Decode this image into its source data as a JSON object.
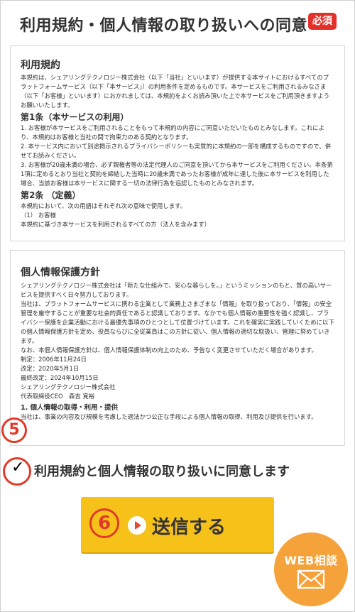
{
  "section": {
    "title": "利用規約・個人情報の取り扱いへの同意",
    "required_badge": "必須"
  },
  "terms": {
    "title": "利用規約",
    "intro": "本規約は、シェアリングテクノロジー株式会社（以下「当社」といいます）が提供する本サイトにおけるすべてのプラットフォームサービス（以下「本サービス」）の利用条件を定めるものです。本サービスをご利用されるみなさま（以下「お客様」といいます）におかれましては、本規約をよくお読み頂いた上で本サービスをご利用頂きますようお願いいたします。",
    "article1_title": "第1条（本サービスの利用）",
    "article1_p1": "1. お客様が本サービスをご利用されることをもって本規約の内容にご同意いただいたものとみなします。これにより、本規約はお客様と当社の間で拘束力のある契約となります。",
    "article1_p2": "2. 本サービス内において別途掲示されるプライバシーポリシーも実質的に本規約の一部を構成するものですので、併せてお読みください。",
    "article1_p3": "3. お客様が20歳未満の場合、必ず親権者等の法定代理人のご同意を頂いてから本サービスをご利用ください。本条第1項に定めるとおり当社と契約を締結した当時に20歳未満であったお客様が成年に達した後に本サービスを利用した場合、当該お客様は本サービスに関する一切の法律行為を追認したものとみなされます。",
    "article2_title": "第2条 （定義）",
    "article2_p1": "本規約において、次の用語はそれぞれ次の意味で使用します。",
    "article2_p2": "（1） お客様",
    "article2_p3": "本規約に基づき本サービスを利用されるすべての方（法人を含みます）"
  },
  "privacy": {
    "title": "個人情報保護方針",
    "p1": "シェアリングテクノロジー株式会社は「新たな仕組みで、安心な暮らしを。」というミッションのもと、質の高いサービスを提供すべく日々努力しております。",
    "p2": "当社は、プラットフォームサービスに携わる企業として業務上さまざまな「情報」を取り扱っており、「情報」の安全管理を厳守することが重要な社会的責任であると認識しております。なかでも個人情報の重要性を強く認識し、プライバシー保護を企業活動における最優先事項のひとつとして位置づけています。これを確実に実践していくために以下の個人情報保護方針を定め、役員ならびに全従業員はこの方針に従い、個人情報の適切な取扱い、管理に努めていきます。",
    "p3": "なお、本個人情報保護方針は、個人情報保護体制の向上のため、予告なく変更させていただく場合があります。",
    "enacted": "制定：2006年11月24日",
    "revised": "改定：2020年5月1日",
    "last_revised": "最終改定：2024年10月15日",
    "company": "シェアリングテクノロジー株式会社",
    "ceo": "代表取締役CEO　森吉 寛裕",
    "item1_title": "1. 個人情報の取得・利用・提供",
    "item1_text": "当社は、事業の内容及び規模を考慮した適法かつ公正な手段による個人情報の取得、利用及び提供を行います。"
  },
  "annotations": {
    "step5": "5",
    "step6": "6"
  },
  "agree": {
    "check_mark": "✓",
    "label": "利用規約と個人情報の取り扱いに同意します",
    "checked": true
  },
  "submit": {
    "label": "送信する"
  },
  "web_consult": {
    "label": "WEB相談",
    "icon": "mail-icon"
  },
  "colors": {
    "required": "#e0312b",
    "submit_bg": "#f6c21a",
    "web_consult_bg": "#f5a23b",
    "annotation": "#e03a2a"
  }
}
